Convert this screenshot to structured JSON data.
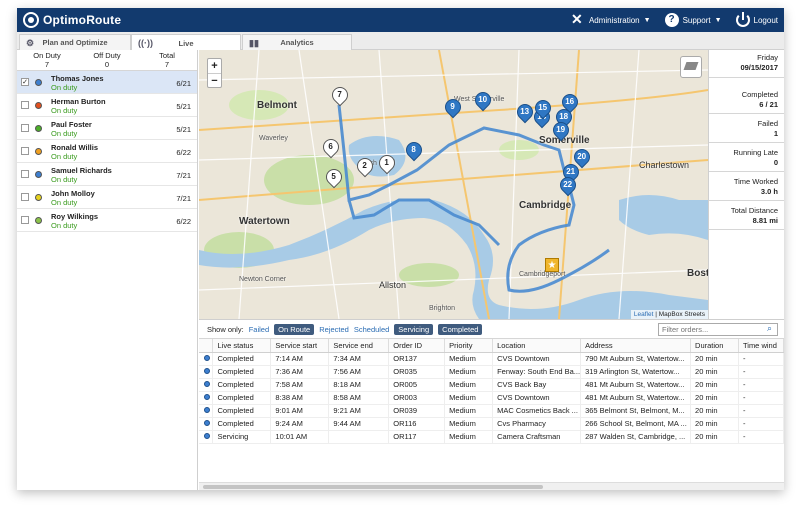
{
  "app": {
    "name": "OptimoRoute",
    "nav": [
      {
        "label": "Administration",
        "icon": "tools-icon"
      },
      {
        "label": "Support",
        "icon": "help-icon"
      },
      {
        "label": "Logout",
        "icon": "power-icon"
      }
    ]
  },
  "tabs": [
    {
      "label": "Plan and Optimize",
      "icon": "gear-icon"
    },
    {
      "label": "Live",
      "icon": "broadcast-icon"
    },
    {
      "label": "Analytics",
      "icon": "bar-chart-icon"
    }
  ],
  "drivers_panel": {
    "stats": [
      {
        "label": "On Duty",
        "value": "7"
      },
      {
        "label": "Off Duty",
        "value": "0"
      },
      {
        "label": "Total",
        "value": "7"
      }
    ],
    "drivers": [
      {
        "name": "Thomas Jones",
        "status": "On duty",
        "count": "6/21",
        "color": "#3d7fd0",
        "selected": true
      },
      {
        "name": "Herman Burton",
        "status": "On duty",
        "count": "5/21",
        "color": "#e2501e",
        "selected": false
      },
      {
        "name": "Paul Foster",
        "status": "On duty",
        "count": "5/21",
        "color": "#4caf28",
        "selected": false
      },
      {
        "name": "Ronald Willis",
        "status": "On duty",
        "count": "6/22",
        "color": "#f0a020",
        "selected": false
      },
      {
        "name": "Samuel Richards",
        "status": "On duty",
        "count": "7/21",
        "color": "#3d7fd0",
        "selected": false
      },
      {
        "name": "John Molloy",
        "status": "On duty",
        "count": "7/21",
        "color": "#e6d21e",
        "selected": false
      },
      {
        "name": "Roy Wilkings",
        "status": "On duty",
        "count": "6/22",
        "color": "#8bc34a",
        "selected": false
      }
    ]
  },
  "map": {
    "labels": [
      "Belmont",
      "Watertown",
      "Cambridge",
      "Somerville",
      "Boston",
      "Charlestown",
      "Newton Corner",
      "Cambridgeport",
      "Allston",
      "Fresh Pond",
      "Waverley",
      "West Somerville",
      "Brighton"
    ],
    "markers_done": [
      "1",
      "2",
      "5",
      "6",
      "7"
    ],
    "markers_route": [
      "8",
      "9",
      "10",
      "13",
      "14",
      "15",
      "16",
      "18",
      "19",
      "20",
      "21",
      "22"
    ],
    "zoom_in": "+",
    "zoom_out": "−",
    "attribution_link": "Leaflet",
    "attribution_text": "| MapBox Streets"
  },
  "summary": {
    "date_day": "Friday",
    "date": "09/15/2017",
    "items": [
      {
        "label": "Completed",
        "value": "6 / 21"
      },
      {
        "label": "Failed",
        "value": "1"
      },
      {
        "label": "Running Late",
        "value": "0"
      },
      {
        "label": "Time Worked",
        "value": "3.0 h"
      },
      {
        "label": "Total Distance",
        "value": "8.81 mi"
      }
    ]
  },
  "orders": {
    "show_only_label": "Show only:",
    "filters": [
      {
        "label": "Failed",
        "active": false
      },
      {
        "label": "On Route",
        "active": true
      },
      {
        "label": "Rejected",
        "active": false
      },
      {
        "label": "Scheduled",
        "active": false
      },
      {
        "label": "Servicing",
        "active": true
      },
      {
        "label": "Completed",
        "active": true
      }
    ],
    "search_placeholder": "Filter orders...",
    "columns": [
      "",
      "Live status",
      "Service start",
      "Service end",
      "Order ID",
      "Priority",
      "Location",
      "Address",
      "Duration",
      "Time wind"
    ],
    "rows": [
      [
        "Completed",
        "7:14 AM",
        "7:34 AM",
        "OR137",
        "Medium",
        "CVS Downtown",
        "790 Mt Auburn St, Watertow...",
        "20 min",
        "-"
      ],
      [
        "Completed",
        "7:36 AM",
        "7:56 AM",
        "OR035",
        "Medium",
        "Fenway: South End Ba...",
        "319 Arlington St, Watertow...",
        "20 min",
        "-"
      ],
      [
        "Completed",
        "7:58 AM",
        "8:18 AM",
        "OR005",
        "Medium",
        "CVS Back Bay",
        "481 Mt Auburn St, Watertow...",
        "20 min",
        "-"
      ],
      [
        "Completed",
        "8:38 AM",
        "8:58 AM",
        "OR003",
        "Medium",
        "CVS Downtown",
        "481 Mt Auburn St, Watertow...",
        "20 min",
        "-"
      ],
      [
        "Completed",
        "9:01 AM",
        "9:21 AM",
        "OR039",
        "Medium",
        "MAC Cosmetics Back ...",
        "365 Belmont St, Belmont, M...",
        "20 min",
        "-"
      ],
      [
        "Completed",
        "9:24 AM",
        "9:44 AM",
        "OR116",
        "Medium",
        "Cvs Pharmacy",
        "266 School St, Belmont, MA ...",
        "20 min",
        "-"
      ],
      [
        "Servicing",
        "10:01 AM",
        "",
        "OR117",
        "Medium",
        "Camera Craftsman",
        "287 Walden St, Cambridge, ...",
        "20 min",
        "-"
      ]
    ]
  }
}
